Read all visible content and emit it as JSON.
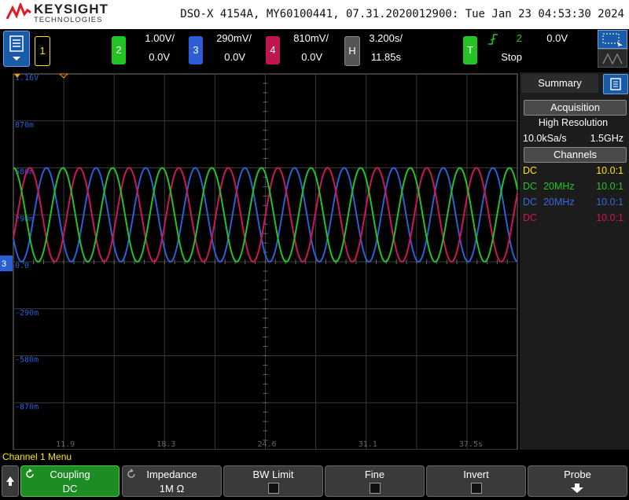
{
  "brand": {
    "name": "KEYSIGHT",
    "sub": "TECHNOLOGIES"
  },
  "title": "DSO-X 4154A, MY60100441, 07.31.2020012900: Tue Jan 23 04:53:30 2024",
  "channels": [
    {
      "num": "1",
      "scale": "",
      "offset": "",
      "color": "#ffe600"
    },
    {
      "num": "2",
      "scale": "1.00V/",
      "offset": "0.0V",
      "color": "#23c323"
    },
    {
      "num": "3",
      "scale": "290mV/",
      "offset": "0.0V",
      "color": "#2c5fd6"
    },
    {
      "num": "4",
      "scale": "810mV/",
      "offset": "0.0V",
      "color": "#c0154d"
    }
  ],
  "horizontal": {
    "label": "H",
    "scale": "3.200s/",
    "delay": "11.85s"
  },
  "trigger": {
    "label": "T",
    "source": "2",
    "level": "0.0V",
    "state": "Stop"
  },
  "grid_labels": {
    "y": [
      "1.16V",
      "870m",
      "580m",
      "290m",
      "0.0",
      "-290m",
      "-580m",
      "-870m"
    ],
    "x": [
      "11.9",
      "18.3",
      "24.6",
      "31.1",
      "37.5s"
    ]
  },
  "ground_marker": "3",
  "side": {
    "tab": "Summary",
    "acq_head": "Acquisition",
    "acq_mode": "High Resolution",
    "sample_rate": "10.0kSa/s",
    "bandwidth": "1.5GHz",
    "ch_head": "Channels",
    "rows": [
      {
        "coupling": "DC",
        "bw": "",
        "probe": "10.0:1",
        "color": "#ffe600"
      },
      {
        "coupling": "DC",
        "bw": "20MHz",
        "probe": "10.0:1",
        "color": "#23c323"
      },
      {
        "coupling": "DC",
        "bw": "20MHz",
        "probe": "10.0:1",
        "color": "#3a66e0"
      },
      {
        "coupling": "DC",
        "bw": "",
        "probe": "10.0:1",
        "color": "#d0145a"
      }
    ]
  },
  "menu_label": "Channel 1 Menu",
  "softkeys": [
    {
      "label": "Coupling",
      "value": "DC"
    },
    {
      "label": "Impedance",
      "value": "1M Ω"
    },
    {
      "label": "BW Limit",
      "value": ""
    },
    {
      "label": "Fine",
      "value": ""
    },
    {
      "label": "Invert",
      "value": ""
    },
    {
      "label": "Probe",
      "value": ""
    }
  ],
  "traces": {
    "ch2": {
      "color": "#23c323",
      "amplitude_v": 290,
      "period_s": 3.15,
      "phase_deg": 0
    },
    "ch3": {
      "color": "#2c5fd6",
      "amplitude_v": 290,
      "period_s": 3.15,
      "phase_deg": 120
    },
    "ch4": {
      "color": "#d0145a",
      "amplitude_v": 290,
      "period_s": 3.15,
      "phase_deg": 240
    }
  }
}
